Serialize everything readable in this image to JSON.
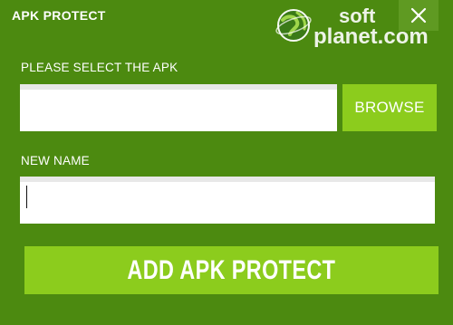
{
  "window": {
    "title": "APK PROTECT"
  },
  "watermark": {
    "line1": "soft",
    "line2": "planet.com"
  },
  "apk_field": {
    "label": "PLEASE SELECT THE APK",
    "value": "",
    "placeholder": ""
  },
  "browse_button": {
    "label": "BROWSE"
  },
  "name_field": {
    "label": "NEW NAME",
    "value": "",
    "placeholder": ""
  },
  "add_button": {
    "label": "ADD APK PROTECT"
  },
  "icons": {
    "close": "close-icon",
    "watermark_globe": "globe-icon"
  },
  "colors": {
    "background": "#4c8a10",
    "accent": "#8ccc1d",
    "close_background": "#5f9a22",
    "text": "#ffffff"
  }
}
